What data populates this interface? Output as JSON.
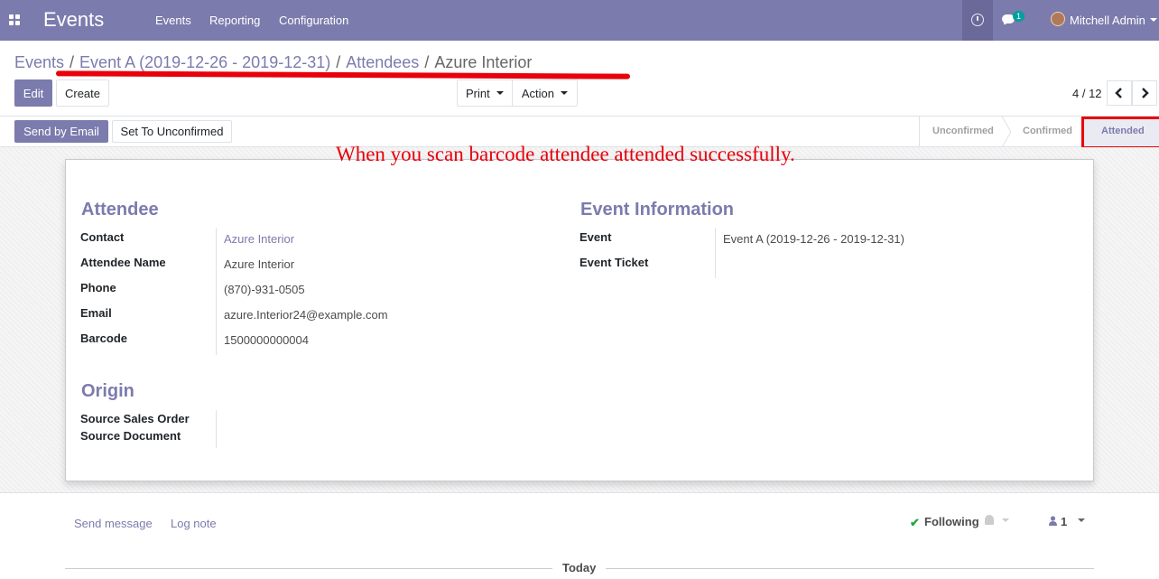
{
  "navbar": {
    "app_title": "Events",
    "menu": [
      "Events",
      "Reporting",
      "Configuration"
    ],
    "chat_badge": "1",
    "user_name": "Mitchell Admin",
    "color": "#7c7bad"
  },
  "breadcrumb": {
    "items": [
      "Events",
      "Event A (2019-12-26 - 2019-12-31)",
      "Attendees"
    ],
    "current": "Azure Interior",
    "separator": "/"
  },
  "toolbar": {
    "edit_label": "Edit",
    "create_label": "Create",
    "print_label": "Print",
    "action_label": "Action",
    "pager": "4 / 12"
  },
  "statusbar": {
    "send_email_label": "Send by Email",
    "set_unconfirmed_label": "Set To Unconfirmed",
    "stages": [
      "Unconfirmed",
      "Confirmed",
      "Attended"
    ],
    "active_stage": "Attended"
  },
  "annotation": "When you scan barcode attendee attended successfully.",
  "attendee": {
    "heading": "Attendee",
    "fields": [
      {
        "label": "Contact",
        "value": "Azure Interior",
        "link": true
      },
      {
        "label": "Attendee Name",
        "value": "Azure Interior"
      },
      {
        "label": "Phone",
        "value": "(870)-931-0505"
      },
      {
        "label": "Email",
        "value": "azure.Interior24@example.com"
      },
      {
        "label": "Barcode",
        "value": "1500000000004"
      }
    ]
  },
  "event_info": {
    "heading": "Event Information",
    "fields": [
      {
        "label": "Event",
        "value": "Event A (2019-12-26 - 2019-12-31)"
      },
      {
        "label": "Event Ticket",
        "value": ""
      }
    ]
  },
  "origin": {
    "heading": "Origin",
    "fields": [
      {
        "label": "Source Sales Order",
        "value": ""
      },
      {
        "label": "Source Document",
        "value": ""
      }
    ]
  },
  "chatter": {
    "send_message": "Send message",
    "log_note": "Log note",
    "following": "Following",
    "followers_count": "1",
    "today": "Today"
  },
  "icons": [
    "apps-grid-icon",
    "clock-icon",
    "chat-icon",
    "avatar",
    "chevron-left-icon",
    "chevron-right-icon",
    "check-icon",
    "bell-icon",
    "user-icon"
  ]
}
